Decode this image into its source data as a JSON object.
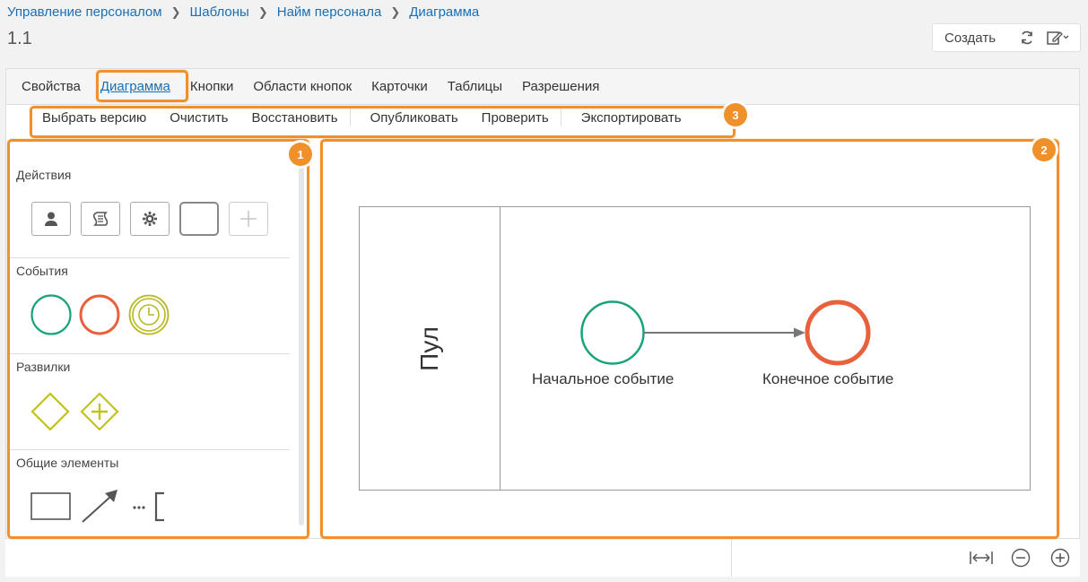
{
  "breadcrumb": [
    "Управление персоналом",
    "Шаблоны",
    "Найм персонала",
    "Диаграмма"
  ],
  "page_title": "1.1",
  "toolbar": {
    "create_label": "Создать"
  },
  "tabs": [
    "Свойства",
    "Диаграмма",
    "Кнопки",
    "Области кнопок",
    "Карточки",
    "Таблицы",
    "Разрешения"
  ],
  "active_tab": "Диаграмма",
  "actions": [
    "Выбрать версию",
    "Очистить",
    "Восстановить",
    "Опубликовать",
    "Проверить",
    "Экспортировать"
  ],
  "palette": {
    "actions": {
      "title": "Действия",
      "tools": [
        "user-task-icon",
        "script-task-icon",
        "service-task-icon",
        "task-icon",
        "add-icon"
      ]
    },
    "events": {
      "title": "События",
      "tools": [
        "start-event-icon",
        "end-event-icon",
        "timer-event-icon"
      ]
    },
    "gateways": {
      "title": "Развилки",
      "tools": [
        "exclusive-gateway-icon",
        "parallel-gateway-icon"
      ]
    },
    "common": {
      "title": "Общие элементы",
      "tools": [
        "pool-icon",
        "connector-arrow-icon",
        "annotation-icon"
      ]
    }
  },
  "diagram": {
    "pool_label": "Пул",
    "start_event_label": "Начальное событие",
    "end_event_label": "Конечное событие"
  },
  "badges": [
    "1",
    "2",
    "3"
  ],
  "colors": {
    "link": "#1a6fb5",
    "highlight": "#f0902a",
    "start_event": "#1aa37a",
    "end_event": "#e8613c",
    "timer_event": "#b8b822",
    "gateway": "#c2c21e"
  }
}
